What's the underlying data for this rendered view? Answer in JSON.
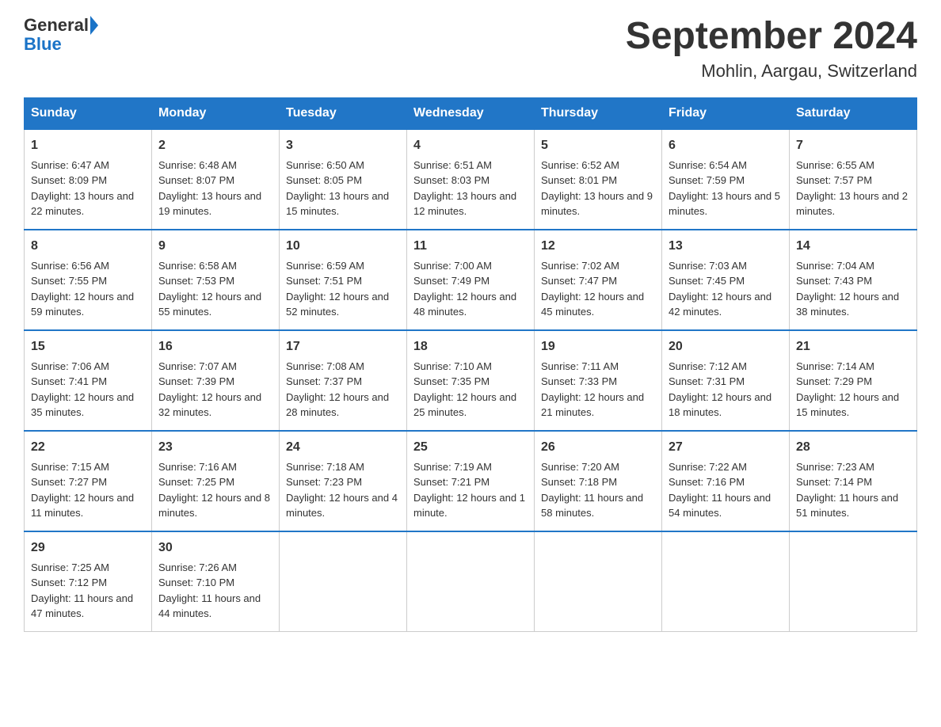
{
  "logo": {
    "general": "General",
    "blue": "Blue"
  },
  "title": "September 2024",
  "subtitle": "Mohlin, Aargau, Switzerland",
  "days": [
    "Sunday",
    "Monday",
    "Tuesday",
    "Wednesday",
    "Thursday",
    "Friday",
    "Saturday"
  ],
  "weeks": [
    [
      {
        "num": "1",
        "sunrise": "Sunrise: 6:47 AM",
        "sunset": "Sunset: 8:09 PM",
        "daylight": "Daylight: 13 hours and 22 minutes."
      },
      {
        "num": "2",
        "sunrise": "Sunrise: 6:48 AM",
        "sunset": "Sunset: 8:07 PM",
        "daylight": "Daylight: 13 hours and 19 minutes."
      },
      {
        "num": "3",
        "sunrise": "Sunrise: 6:50 AM",
        "sunset": "Sunset: 8:05 PM",
        "daylight": "Daylight: 13 hours and 15 minutes."
      },
      {
        "num": "4",
        "sunrise": "Sunrise: 6:51 AM",
        "sunset": "Sunset: 8:03 PM",
        "daylight": "Daylight: 13 hours and 12 minutes."
      },
      {
        "num": "5",
        "sunrise": "Sunrise: 6:52 AM",
        "sunset": "Sunset: 8:01 PM",
        "daylight": "Daylight: 13 hours and 9 minutes."
      },
      {
        "num": "6",
        "sunrise": "Sunrise: 6:54 AM",
        "sunset": "Sunset: 7:59 PM",
        "daylight": "Daylight: 13 hours and 5 minutes."
      },
      {
        "num": "7",
        "sunrise": "Sunrise: 6:55 AM",
        "sunset": "Sunset: 7:57 PM",
        "daylight": "Daylight: 13 hours and 2 minutes."
      }
    ],
    [
      {
        "num": "8",
        "sunrise": "Sunrise: 6:56 AM",
        "sunset": "Sunset: 7:55 PM",
        "daylight": "Daylight: 12 hours and 59 minutes."
      },
      {
        "num": "9",
        "sunrise": "Sunrise: 6:58 AM",
        "sunset": "Sunset: 7:53 PM",
        "daylight": "Daylight: 12 hours and 55 minutes."
      },
      {
        "num": "10",
        "sunrise": "Sunrise: 6:59 AM",
        "sunset": "Sunset: 7:51 PM",
        "daylight": "Daylight: 12 hours and 52 minutes."
      },
      {
        "num": "11",
        "sunrise": "Sunrise: 7:00 AM",
        "sunset": "Sunset: 7:49 PM",
        "daylight": "Daylight: 12 hours and 48 minutes."
      },
      {
        "num": "12",
        "sunrise": "Sunrise: 7:02 AM",
        "sunset": "Sunset: 7:47 PM",
        "daylight": "Daylight: 12 hours and 45 minutes."
      },
      {
        "num": "13",
        "sunrise": "Sunrise: 7:03 AM",
        "sunset": "Sunset: 7:45 PM",
        "daylight": "Daylight: 12 hours and 42 minutes."
      },
      {
        "num": "14",
        "sunrise": "Sunrise: 7:04 AM",
        "sunset": "Sunset: 7:43 PM",
        "daylight": "Daylight: 12 hours and 38 minutes."
      }
    ],
    [
      {
        "num": "15",
        "sunrise": "Sunrise: 7:06 AM",
        "sunset": "Sunset: 7:41 PM",
        "daylight": "Daylight: 12 hours and 35 minutes."
      },
      {
        "num": "16",
        "sunrise": "Sunrise: 7:07 AM",
        "sunset": "Sunset: 7:39 PM",
        "daylight": "Daylight: 12 hours and 32 minutes."
      },
      {
        "num": "17",
        "sunrise": "Sunrise: 7:08 AM",
        "sunset": "Sunset: 7:37 PM",
        "daylight": "Daylight: 12 hours and 28 minutes."
      },
      {
        "num": "18",
        "sunrise": "Sunrise: 7:10 AM",
        "sunset": "Sunset: 7:35 PM",
        "daylight": "Daylight: 12 hours and 25 minutes."
      },
      {
        "num": "19",
        "sunrise": "Sunrise: 7:11 AM",
        "sunset": "Sunset: 7:33 PM",
        "daylight": "Daylight: 12 hours and 21 minutes."
      },
      {
        "num": "20",
        "sunrise": "Sunrise: 7:12 AM",
        "sunset": "Sunset: 7:31 PM",
        "daylight": "Daylight: 12 hours and 18 minutes."
      },
      {
        "num": "21",
        "sunrise": "Sunrise: 7:14 AM",
        "sunset": "Sunset: 7:29 PM",
        "daylight": "Daylight: 12 hours and 15 minutes."
      }
    ],
    [
      {
        "num": "22",
        "sunrise": "Sunrise: 7:15 AM",
        "sunset": "Sunset: 7:27 PM",
        "daylight": "Daylight: 12 hours and 11 minutes."
      },
      {
        "num": "23",
        "sunrise": "Sunrise: 7:16 AM",
        "sunset": "Sunset: 7:25 PM",
        "daylight": "Daylight: 12 hours and 8 minutes."
      },
      {
        "num": "24",
        "sunrise": "Sunrise: 7:18 AM",
        "sunset": "Sunset: 7:23 PM",
        "daylight": "Daylight: 12 hours and 4 minutes."
      },
      {
        "num": "25",
        "sunrise": "Sunrise: 7:19 AM",
        "sunset": "Sunset: 7:21 PM",
        "daylight": "Daylight: 12 hours and 1 minute."
      },
      {
        "num": "26",
        "sunrise": "Sunrise: 7:20 AM",
        "sunset": "Sunset: 7:18 PM",
        "daylight": "Daylight: 11 hours and 58 minutes."
      },
      {
        "num": "27",
        "sunrise": "Sunrise: 7:22 AM",
        "sunset": "Sunset: 7:16 PM",
        "daylight": "Daylight: 11 hours and 54 minutes."
      },
      {
        "num": "28",
        "sunrise": "Sunrise: 7:23 AM",
        "sunset": "Sunset: 7:14 PM",
        "daylight": "Daylight: 11 hours and 51 minutes."
      }
    ],
    [
      {
        "num": "29",
        "sunrise": "Sunrise: 7:25 AM",
        "sunset": "Sunset: 7:12 PM",
        "daylight": "Daylight: 11 hours and 47 minutes."
      },
      {
        "num": "30",
        "sunrise": "Sunrise: 7:26 AM",
        "sunset": "Sunset: 7:10 PM",
        "daylight": "Daylight: 11 hours and 44 minutes."
      },
      null,
      null,
      null,
      null,
      null
    ]
  ]
}
